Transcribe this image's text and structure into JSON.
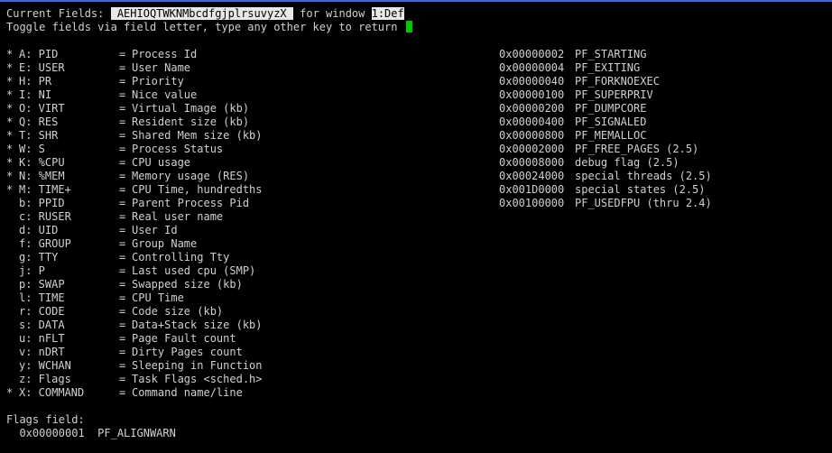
{
  "header": {
    "current_label": "Current Fields: ",
    "fields_string": " AEHIOQTWKNMbcdfgjplrsuvyzX ",
    "window_label": " for window ",
    "window_value": "1:Def",
    "help_text": "Toggle fields via field letter, type any other key to return "
  },
  "fields": [
    {
      "star": "*",
      "key": "A: PID",
      "desc": "Process Id"
    },
    {
      "star": "*",
      "key": "E: USER",
      "desc": "User Name"
    },
    {
      "star": "*",
      "key": "H: PR",
      "desc": "Priority"
    },
    {
      "star": "*",
      "key": "I: NI",
      "desc": "Nice value"
    },
    {
      "star": "*",
      "key": "O: VIRT",
      "desc": "Virtual Image (kb)"
    },
    {
      "star": "*",
      "key": "Q: RES",
      "desc": "Resident size (kb)"
    },
    {
      "star": "*",
      "key": "T: SHR",
      "desc": "Shared Mem size (kb)"
    },
    {
      "star": "*",
      "key": "W: S",
      "desc": "Process Status"
    },
    {
      "star": "*",
      "key": "K: %CPU",
      "desc": "CPU usage"
    },
    {
      "star": "*",
      "key": "N: %MEM",
      "desc": "Memory usage (RES)"
    },
    {
      "star": "*",
      "key": "M: TIME+",
      "desc": "CPU Time, hundredths"
    },
    {
      "star": "",
      "key": "b: PPID",
      "desc": "Parent Process Pid"
    },
    {
      "star": "",
      "key": "c: RUSER",
      "desc": "Real user name"
    },
    {
      "star": "",
      "key": "d: UID",
      "desc": "User Id"
    },
    {
      "star": "",
      "key": "f: GROUP",
      "desc": "Group Name"
    },
    {
      "star": "",
      "key": "g: TTY",
      "desc": "Controlling Tty"
    },
    {
      "star": "",
      "key": "j: P",
      "desc": "Last used cpu (SMP)"
    },
    {
      "star": "",
      "key": "p: SWAP",
      "desc": "Swapped size (kb)"
    },
    {
      "star": "",
      "key": "l: TIME",
      "desc": "CPU Time"
    },
    {
      "star": "",
      "key": "r: CODE",
      "desc": "Code size (kb)"
    },
    {
      "star": "",
      "key": "s: DATA",
      "desc": "Data+Stack size (kb)"
    },
    {
      "star": "",
      "key": "u: nFLT",
      "desc": "Page Fault count"
    },
    {
      "star": "",
      "key": "v: nDRT",
      "desc": "Dirty Pages count"
    },
    {
      "star": "",
      "key": "y: WCHAN",
      "desc": "Sleeping in Function"
    },
    {
      "star": "",
      "key": "z: Flags",
      "desc": "Task Flags <sched.h>"
    },
    {
      "star": "*",
      "key": "X: COMMAND",
      "desc": "Command name/line"
    }
  ],
  "flags": [
    {
      "hex": "0x00000002",
      "name": "PF_STARTING"
    },
    {
      "hex": "0x00000004",
      "name": "PF_EXITING"
    },
    {
      "hex": "0x00000040",
      "name": "PF_FORKNOEXEC"
    },
    {
      "hex": "0x00000100",
      "name": "PF_SUPERPRIV"
    },
    {
      "hex": "0x00000200",
      "name": "PF_DUMPCORE"
    },
    {
      "hex": "0x00000400",
      "name": "PF_SIGNALED"
    },
    {
      "hex": "0x00000800",
      "name": "PF_MEMALLOC"
    },
    {
      "hex": "0x00002000",
      "name": "PF_FREE_PAGES (2.5)"
    },
    {
      "hex": "0x00008000",
      "name": "debug flag (2.5)"
    },
    {
      "hex": "0x00024000",
      "name": "special threads (2.5)"
    },
    {
      "hex": "0x001D0000",
      "name": "special states (2.5)"
    },
    {
      "hex": "0x00100000",
      "name": "PF_USEDFPU (thru 2.4)"
    }
  ],
  "footer": {
    "flags_label": "Flags field:",
    "flags_value": "  0x00000001  PF_ALIGNWARN"
  },
  "colors": {
    "background": "#000000",
    "text": "#d0d0d0",
    "highlight": "#e8e8e8",
    "cursor": "#00c800",
    "top_border": "#2d6fd4"
  }
}
